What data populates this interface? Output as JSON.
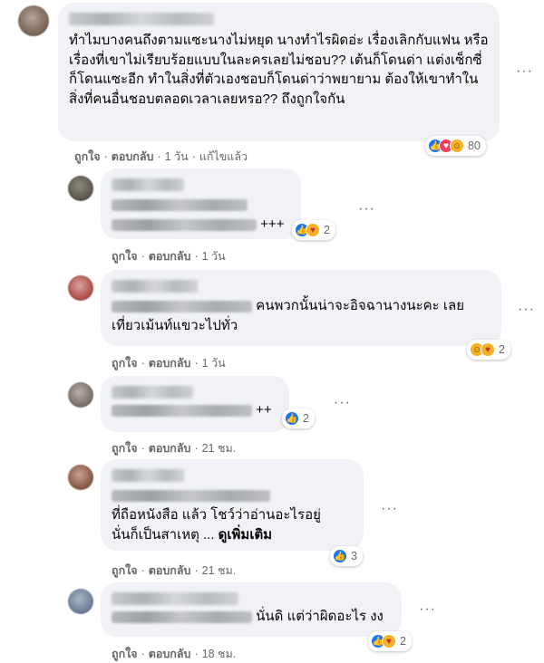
{
  "comments": [
    {
      "text": "ทำไมบางคนถึงตามแซะนางไม่หยุด นางทำไรผิดอ่ะ เรื่องเลิกกับแฟน หรือเรื่องที่เขาไม่เรียบร้อยแบบในละครเลยไม่ชอบ?? เต้นก็โดนด่า แต่งเซ็กซี่ก็โดนแซะอีก ทำในสิ่งที่ตัวเองชอบก็โดนด่าว่าพยายาม ต้องให้เขาทำในสิ่งที่คนอื่นชอบตลอดเวลาเลยหรอ?? ถึงถูกใจกัน",
      "like": "ถูกใจ",
      "reply": "ตอบกลับ",
      "time": "1 วัน",
      "edited": "แก้ไขแล้ว",
      "reaction_count": "80",
      "reaction_icons": [
        "like-icon",
        "love-icon",
        "haha-icon"
      ]
    },
    {
      "suffix": "+++",
      "like": "ถูกใจ",
      "reply": "ตอบกลับ",
      "time": "1 วัน",
      "reaction_count": "2",
      "reaction_icons": [
        "like-icon",
        "care-icon"
      ]
    },
    {
      "line1": "คนพวกนั้นน่าจะอิจฉานางนะคะ เลย",
      "line2": "เที่ยวเม้นท์แขวะไปทั่ว",
      "like": "ถูกใจ",
      "reply": "ตอบกลับ",
      "time": "1 วัน",
      "reaction_count": "2",
      "reaction_icons": [
        "haha-icon",
        "care-icon"
      ]
    },
    {
      "suffix": "++",
      "like": "ถูกใจ",
      "reply": "ตอบกลับ",
      "time": "21 ชม.",
      "reaction_count": "2",
      "reaction_icons": [
        "like-icon"
      ]
    },
    {
      "line1": "ที่ถือหนังสือ แล้ว โชว์ว่าอ่านอะไรอยู่",
      "line2": "นั่นก็เป็นสาเหตุ ...",
      "see_more": "ดูเพิ่มเติม",
      "like": "ถูกใจ",
      "reply": "ตอบกลับ",
      "time": "21 ชม.",
      "reaction_count": "3",
      "reaction_icons": [
        "like-icon"
      ]
    },
    {
      "suffix": "นั่นดิ แต่ว่าผิดอะไร งง",
      "like": "ถูกใจ",
      "reply": "ตอบกลับ",
      "time": "18 ชม.",
      "reaction_count": "2",
      "reaction_icons": [
        "like-icon",
        "care-icon"
      ]
    }
  ],
  "more_icon": "more-options-icon"
}
